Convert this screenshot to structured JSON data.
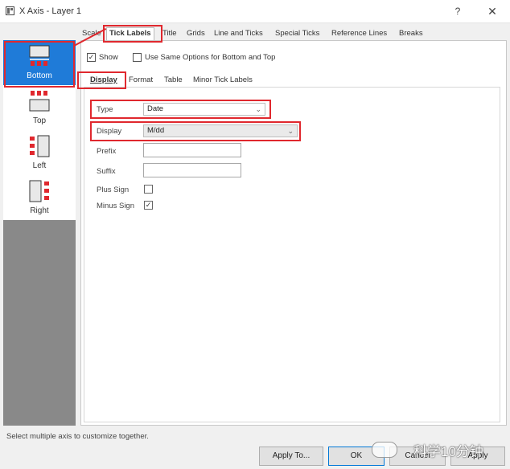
{
  "window": {
    "title": "X Axis - Layer 1",
    "help_symbol": "?",
    "close_symbol": "✕"
  },
  "sidebar": {
    "items": [
      {
        "label": "Bottom",
        "selected": true,
        "icon": "bottom-axis-icon"
      },
      {
        "label": "Top",
        "selected": false,
        "icon": "top-axis-icon"
      },
      {
        "label": "Left",
        "selected": false,
        "icon": "left-axis-icon"
      },
      {
        "label": "Right",
        "selected": false,
        "icon": "right-axis-icon"
      }
    ]
  },
  "tabs": [
    "Scale",
    "Tick Labels",
    "Title",
    "Grids",
    "Line and Ticks",
    "Special Ticks",
    "Reference Lines",
    "Breaks"
  ],
  "active_tab": "Tick Labels",
  "show": {
    "label": "Show",
    "checked": true,
    "check_mark": "✓"
  },
  "same_options": {
    "label": "Use Same Options for Bottom and Top",
    "checked": false
  },
  "subtabs": [
    "Display",
    "Format",
    "Table",
    "Minor Tick Labels"
  ],
  "active_subtab": "Display",
  "display": {
    "type_label": "Type",
    "type_value": "Date",
    "display_label": "Display",
    "display_value": "M/dd",
    "prefix_label": "Prefix",
    "prefix_value": "",
    "suffix_label": "Suffix",
    "suffix_value": "",
    "plus_sign_label": "Plus Sign",
    "plus_sign_checked": false,
    "minus_sign_label": "Minus Sign",
    "minus_sign_checked": true,
    "check_mark": "✓",
    "dropdown_arrow": "⌄"
  },
  "status_text": "Select multiple axis to customize together.",
  "buttons": {
    "apply_to": "Apply To...",
    "ok": "OK",
    "cancel": "Cancel",
    "apply": "Apply"
  },
  "watermark": {
    "text": "科学10分钟"
  },
  "colors": {
    "selection": "#1f7bd8",
    "highlight": "#e0282e",
    "sidebar_bg": "#898989"
  }
}
